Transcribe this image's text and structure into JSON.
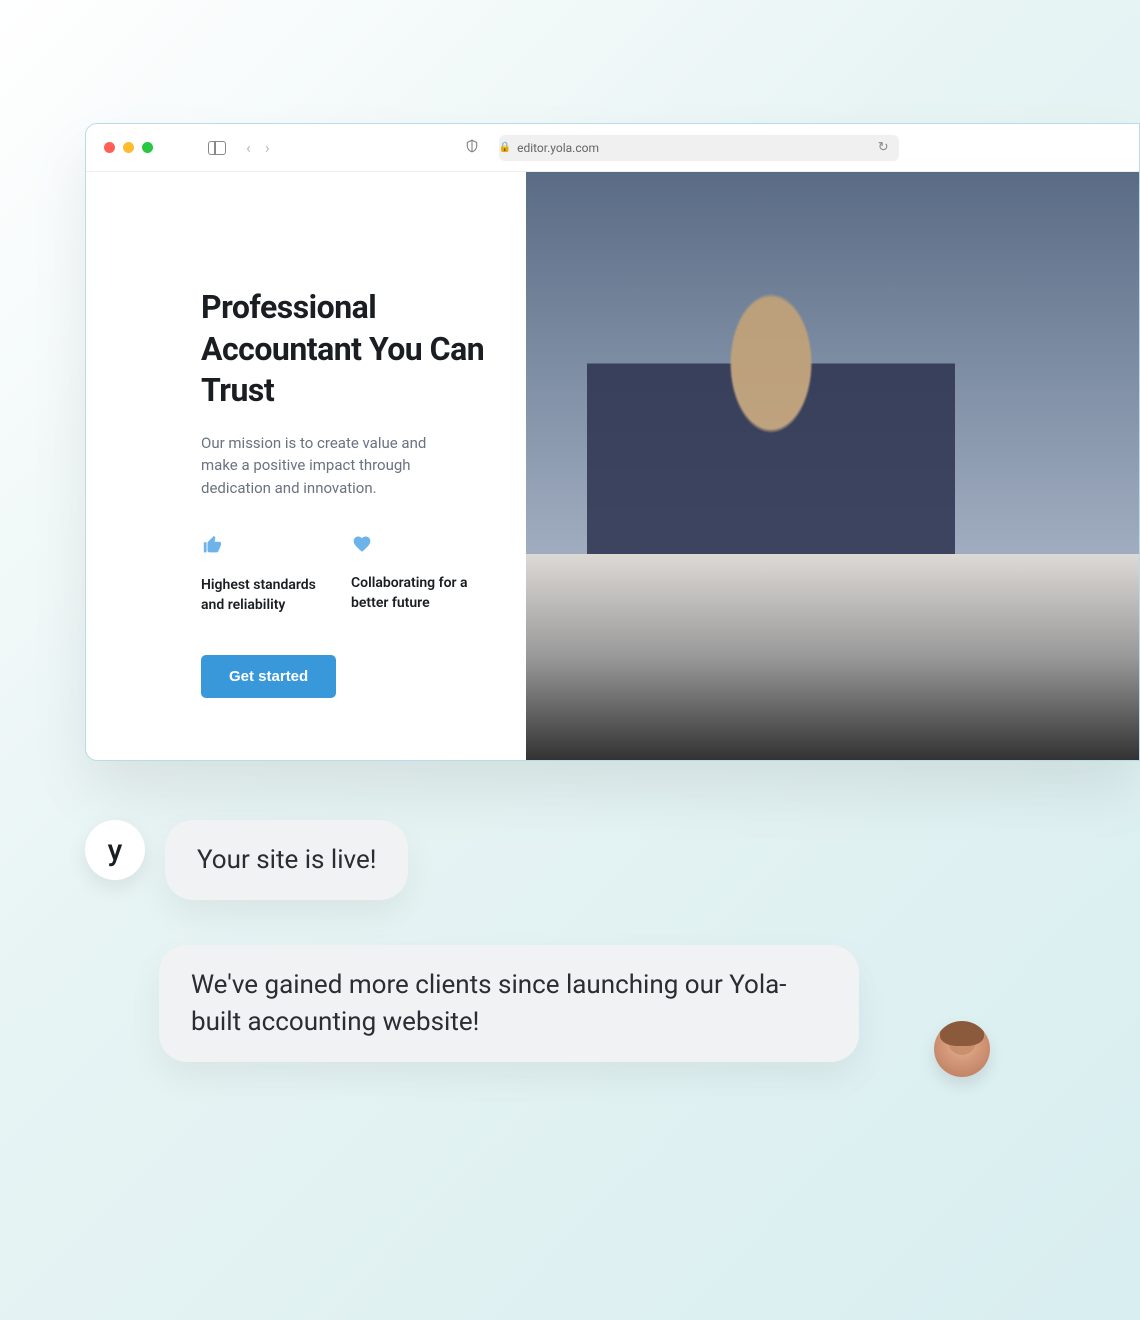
{
  "browser": {
    "url": "editor.yola.com"
  },
  "hero": {
    "title": "Professional Accountant You Can Trust",
    "subtitle": "Our mission is to create value and make a positive impact through dedication and innovation.",
    "cta_label": "Get started"
  },
  "features": [
    {
      "icon": "thumbs-up",
      "text": "Highest standards and reliability"
    },
    {
      "icon": "heart",
      "text": "Collaborating for a better future"
    }
  ],
  "chat": {
    "avatar_left_initial": "y",
    "message_1": "Your site is live!",
    "message_2": "We've gained more clients since launching our Yola-built accounting website!"
  }
}
